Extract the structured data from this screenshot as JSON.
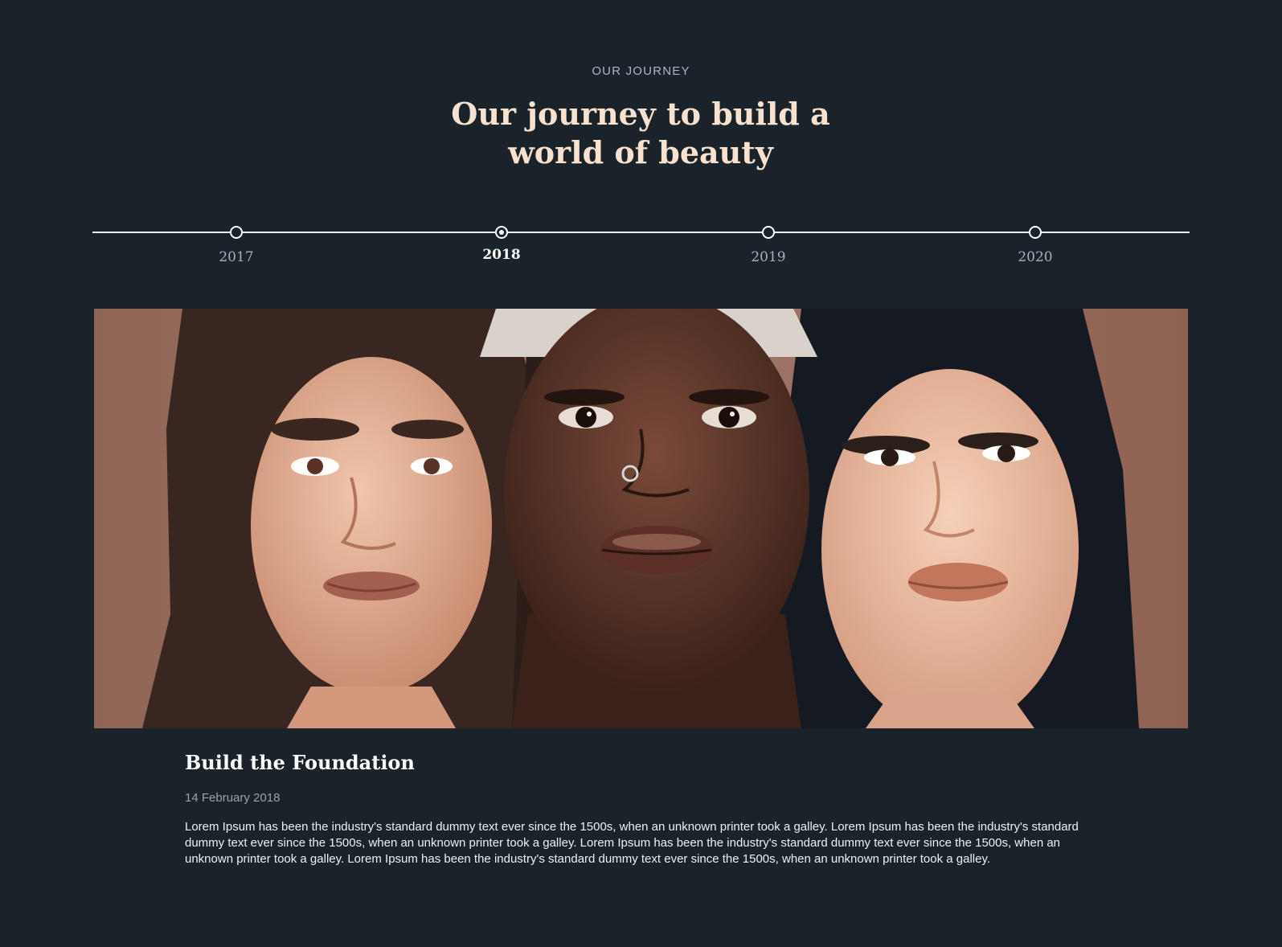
{
  "section": {
    "eyebrow": "OUR JOURNEY",
    "headline": "Our journey to build a world of beauty"
  },
  "timeline": {
    "years": [
      "2017",
      "2018",
      "2019",
      "2020"
    ],
    "active_year": "2018"
  },
  "hero_image": {
    "description": "Close-up portrait of three women with different skin tones against a warm brown backdrop"
  },
  "story": {
    "title": "Build the Foundation",
    "date": "14 February 2018",
    "body": "Lorem Ipsum has been the industry's standard dummy text ever since the 1500s, when an unknown printer took a galley. Lorem Ipsum has been the industry's standard dummy text ever since the 1500s, when an unknown printer took a galley. Lorem Ipsum has been the industry's standard dummy text ever since the 1500s, when an unknown printer took a galley. Lorem Ipsum has been the industry's standard dummy text ever since the 1500s, when an unknown printer took a galley."
  },
  "colors": {
    "background": "#1a222a",
    "headline": "#f8e1cf",
    "eyebrow": "#aeb6c6",
    "timeline_line": "#eeeeee",
    "active_year": "#ffffff",
    "inactive_year": "#a7b0bf",
    "date": "#99a2b0",
    "body_text": "#eef1f4",
    "photo_backdrop": "#9a6f5e"
  }
}
